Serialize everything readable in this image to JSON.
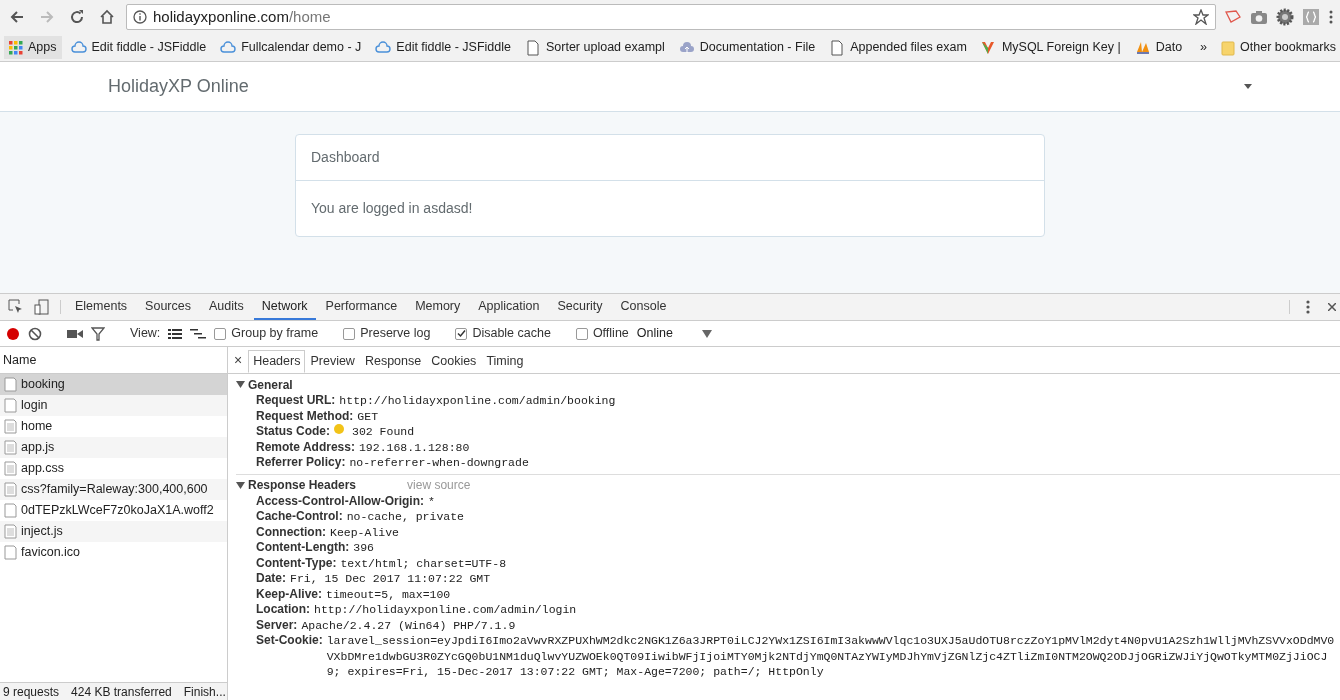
{
  "browser": {
    "address": {
      "host": "holidayxponline.com",
      "path": "/home"
    },
    "apps": "Apps",
    "bookmarks": [
      {
        "label": "Edit fiddle - JSFiddle",
        "kind": "cloud"
      },
      {
        "label": "Fullcalendar demo - J",
        "kind": "cloud"
      },
      {
        "label": "Edit fiddle - JSFiddle",
        "kind": "cloud"
      },
      {
        "label": "Sorter upload exampl",
        "kind": "page"
      },
      {
        "label": "Documentation - File",
        "kind": "upload"
      },
      {
        "label": "Appended files exam",
        "kind": "page"
      },
      {
        "label": "MySQL Foreign Key |",
        "kind": "mysql"
      },
      {
        "label": "Dato",
        "kind": "pma"
      }
    ],
    "overflow": "»",
    "other_bookmarks": "Other bookmarks"
  },
  "page": {
    "brand": "HolidayXP Online",
    "card_title": "Dashboard",
    "card_body": "You are logged in asdasd!"
  },
  "devtools": {
    "tabs": [
      {
        "label": "Elements",
        "selected": false
      },
      {
        "label": "Sources",
        "selected": false
      },
      {
        "label": "Audits",
        "selected": false
      },
      {
        "label": "Network",
        "selected": true
      },
      {
        "label": "Performance",
        "selected": false
      },
      {
        "label": "Memory",
        "selected": false
      },
      {
        "label": "Application",
        "selected": false
      },
      {
        "label": "Security",
        "selected": false
      },
      {
        "label": "Console",
        "selected": false
      }
    ],
    "recording": true,
    "view_label": "View:",
    "options": [
      {
        "label": "Group by frame",
        "checked": false
      },
      {
        "label": "Preserve log",
        "checked": false
      },
      {
        "label": "Disable cache",
        "checked": true
      },
      {
        "label": "Offline",
        "checked": false
      }
    ],
    "throttle": "Online",
    "name_header": "Name",
    "requests": [
      {
        "name": "booking",
        "kind": "doc",
        "selected": true
      },
      {
        "name": "login",
        "kind": "doc",
        "selected": false
      },
      {
        "name": "home",
        "kind": "text",
        "selected": false
      },
      {
        "name": "app.js",
        "kind": "text",
        "selected": false
      },
      {
        "name": "app.css",
        "kind": "text",
        "selected": false
      },
      {
        "name": "css?family=Raleway:300,400,600",
        "kind": "text",
        "selected": false
      },
      {
        "name": "0dTEPzkLWceF7z0koJaX1A.woff2",
        "kind": "doc",
        "selected": false
      },
      {
        "name": "inject.js",
        "kind": "text",
        "selected": false
      },
      {
        "name": "favicon.ico",
        "kind": "doc",
        "selected": false
      }
    ],
    "summary": [
      "9 requests",
      "424 KB transferred",
      "Finish..."
    ],
    "close": "×",
    "detail_tabs": [
      {
        "label": "Headers",
        "selected": true
      },
      {
        "label": "Preview",
        "selected": false
      },
      {
        "label": "Response",
        "selected": false
      },
      {
        "label": "Cookies",
        "selected": false
      },
      {
        "label": "Timing",
        "selected": false
      }
    ],
    "sections": [
      {
        "title": "General",
        "expanded": true,
        "rows": [
          {
            "key": "Request URL:",
            "value": "http://holidayxponline.com/admin/booking"
          },
          {
            "key": "Request Method:",
            "value": "GET"
          },
          {
            "key": "Status Code:",
            "value": "302 Found",
            "color": "#f2c318"
          },
          {
            "key": "Remote Address:",
            "value": "192.168.1.128:80"
          },
          {
            "key": "Referrer Policy:",
            "value": "no-referrer-when-downgrade"
          }
        ]
      },
      {
        "title": "Response Headers",
        "expanded": true,
        "link": "view source",
        "rows": [
          {
            "key": "Access-Control-Allow-Origin:",
            "value": "*"
          },
          {
            "key": "Cache-Control:",
            "value": "no-cache, private"
          },
          {
            "key": "Connection:",
            "value": "Keep-Alive"
          },
          {
            "key": "Content-Length:",
            "value": "396"
          },
          {
            "key": "Content-Type:",
            "value": "text/html; charset=UTF-8"
          },
          {
            "key": "Date:",
            "value": "Fri, 15 Dec 2017 11:07:22 GMT"
          },
          {
            "key": "Keep-Alive:",
            "value": "timeout=5, max=100"
          },
          {
            "key": "Location:",
            "value": "http://holidayxponline.com/admin/login"
          },
          {
            "key": "Server:",
            "value": "Apache/2.4.27 (Win64) PHP/7.1.9"
          },
          {
            "key": "Set-Cookie:",
            "value": "laravel_session=eyJpdiI6Imo2aVwvRXZPUXhWM2dkc2NGK1Z6a3JRPT0iLCJ2YWx1ZSI6ImI3akwwWVlqc1o3UXJ5aUdOTU8rczZoY1pMVlM2dyt4N0pvU1A2Szh1WlljMVhZSVVxODdMV0VXbDMre1dwbGU3R0ZYcGQ0bU1NM1duQlwvYUZWOEk0QT09IiwibWFjIjoiMTY0Mjk2NTdjYmQ0NTAzYWIyMDJhYmVjZGNlZjc4ZTliZmI0NTM2OWQ2ODJjOGRiZWJiYjQwOTkyMTM0ZjJiOCJ9; expires=Fri, 15-Dec-2017 13:07:22 GMT; Max-Age=7200; path=/; HttpOnly"
          }
        ]
      }
    ]
  }
}
